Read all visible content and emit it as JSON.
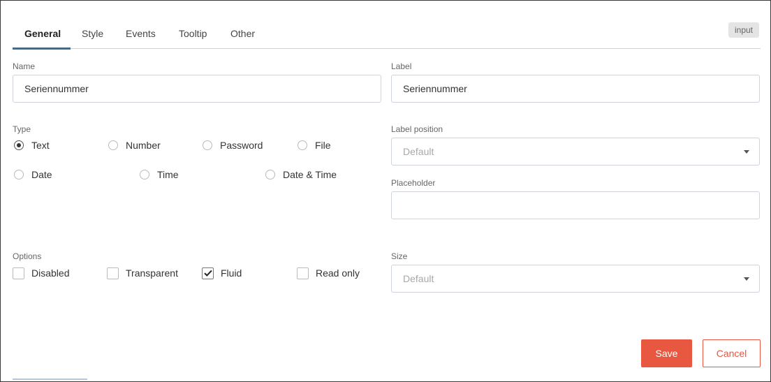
{
  "tabs": [
    {
      "label": "General",
      "active": true
    },
    {
      "label": "Style"
    },
    {
      "label": "Events"
    },
    {
      "label": "Tooltip"
    },
    {
      "label": "Other"
    }
  ],
  "type_badge": "input",
  "name_field": {
    "label": "Name",
    "value": "Seriennummer"
  },
  "label_field": {
    "label": "Label",
    "value": "Seriennummer"
  },
  "type_group": {
    "label": "Type",
    "selected": "Text",
    "options": [
      "Text",
      "Number",
      "Password",
      "File",
      "Date",
      "Time",
      "Date & Time"
    ]
  },
  "label_position": {
    "label": "Label position",
    "value": "Default"
  },
  "placeholder_field": {
    "label": "Placeholder",
    "value": ""
  },
  "options_group": {
    "label": "Options",
    "items": [
      {
        "label": "Disabled",
        "checked": false
      },
      {
        "label": "Transparent",
        "checked": false
      },
      {
        "label": "Fluid",
        "checked": true
      },
      {
        "label": "Read only",
        "checked": false
      }
    ]
  },
  "size_field": {
    "label": "Size",
    "value": "Default"
  },
  "buttons": {
    "save": "Save",
    "cancel": "Cancel"
  },
  "colors": {
    "accent": "#e8573f",
    "tab_underline": "#4a6a84",
    "border": "#cfd4da"
  }
}
